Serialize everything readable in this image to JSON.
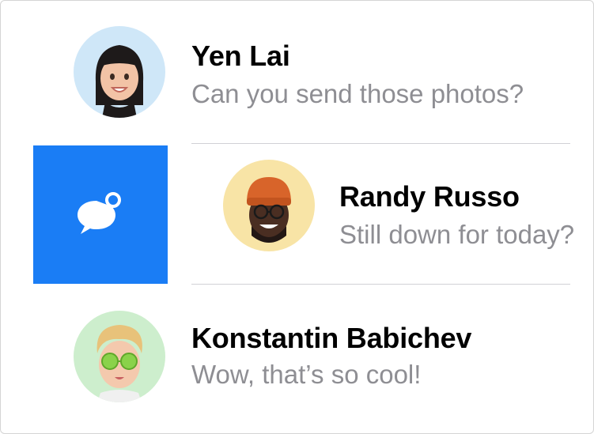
{
  "conversations": [
    {
      "name": "Yen Lai",
      "preview": "Can you send those photos?",
      "avatar": "memoji-woman-bangs",
      "avatar_bg": "#cfe7f8"
    },
    {
      "name": "Randy Russo",
      "preview": "Still down for today?",
      "avatar": "memoji-man-beanie",
      "avatar_bg": "#f8e4a6"
    },
    {
      "name": "Konstantin Babichev",
      "preview": "Wow, that’s so cool!",
      "avatar": "memoji-man-green-glasses",
      "avatar_bg": "#cdeecd"
    }
  ],
  "swipe_action": {
    "icon": "unread-message-bubble-icon",
    "color": "#1a7df5"
  },
  "colors": {
    "preview_text": "#8e8e93",
    "divider": "#d1d1d6"
  }
}
